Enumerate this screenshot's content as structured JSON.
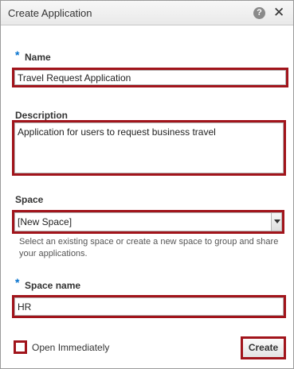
{
  "dialog": {
    "title": "Create Application",
    "help_icon": "help-icon",
    "help_glyph": "?",
    "close_icon": "close-icon",
    "close_glyph": "✕"
  },
  "form": {
    "name": {
      "required_marker": "*",
      "label": "Name",
      "value": "Travel Request Application"
    },
    "description": {
      "label": "Description",
      "value": "Application for users to request business travel"
    },
    "space": {
      "label": "Space",
      "selected": "[New Space]",
      "help_text": "Select an existing space or create a new space to group and share your applications."
    },
    "space_name": {
      "required_marker": "*",
      "label": "Space name",
      "value": "HR"
    },
    "open_immediately": {
      "label": "Open Immediately",
      "checked": false
    }
  },
  "actions": {
    "create_label": "Create"
  },
  "colors": {
    "highlight": "#a1141b",
    "required": "#0572ce"
  }
}
